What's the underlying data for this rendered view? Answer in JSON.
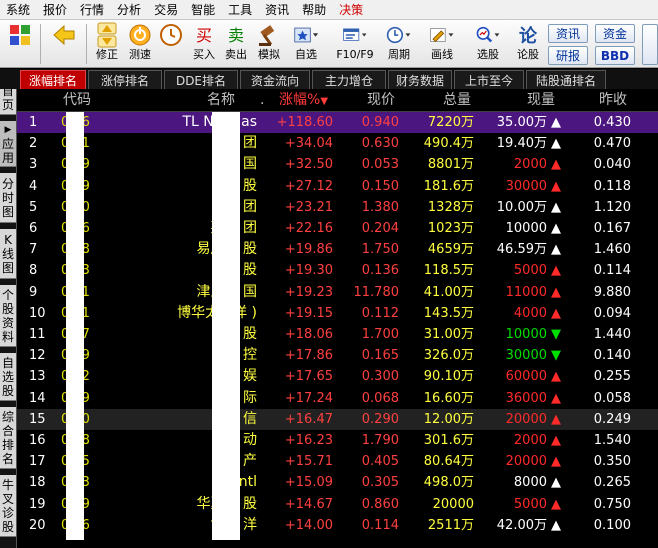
{
  "menu": [
    "系统",
    "报价",
    "行情",
    "分析",
    "交易",
    "智能",
    "工具",
    "资讯",
    "帮助",
    "决策"
  ],
  "toolbar": {
    "labels": [
      "修正",
      "测速",
      "买入",
      "卖出",
      "模拟",
      "自选",
      "F10/F9",
      "周期",
      "画线",
      "选股",
      "论股"
    ],
    "right_buttons": [
      "资讯",
      "资金",
      "研报",
      "BBD"
    ],
    "colors": {
      "buy": "#d00000",
      "sell": "#008000",
      "accent": "#003399"
    }
  },
  "tabs": [
    "涨幅排名",
    "涨停排名",
    "DDE排名",
    "资金流向",
    "主力增仓",
    "财务数据",
    "上市至今",
    "陆股通排名"
  ],
  "left_tabs": [
    "首页",
    "应用",
    "分时图",
    "K线图",
    "个股资料",
    "自选股",
    "综合排名",
    "牛叉诊股"
  ],
  "headers": {
    "code": "代码",
    "name": "名称",
    "dot": ".",
    "chg": "涨幅%",
    "sort_icon": "down-arrow",
    "price": "现价",
    "vol": "总量",
    "cur": "现量",
    "prev": "昨收"
  },
  "rows": [
    {
      "idx": "1",
      "code": "0   36",
      "name": "TL Natu      as",
      "chg": "+118.60",
      "price": "0.940",
      "vol": "7220万",
      "cur": "35.00万",
      "dir": "up",
      "cur_color": "white",
      "prev": "0.430"
    },
    {
      "idx": "2",
      "code": "0   01",
      "name": "源      团",
      "chg": "+34.04",
      "price": "0.630",
      "vol": "490.4万",
      "cur": "19.40万",
      "dir": "up",
      "cur_color": "white",
      "prev": "0.470"
    },
    {
      "idx": "3",
      "code": "0   09",
      "name": "新      国",
      "chg": "+32.50",
      "price": "0.053",
      "vol": "8801万",
      "cur": "2000",
      "dir": "up",
      "cur_color": "red",
      "prev": "0.040"
    },
    {
      "idx": "4",
      "code": "0   69",
      "name": "富      股",
      "chg": "+27.12",
      "price": "0.150",
      "vol": "181.6万",
      "cur": "30000",
      "dir": "up",
      "cur_color": "red",
      "prev": "0.118"
    },
    {
      "idx": "5",
      "code": "0   50",
      "name": "海      团",
      "chg": "+23.21",
      "price": "1.380",
      "vol": "1328万",
      "cur": "10.00万",
      "dir": "up",
      "cur_color": "white",
      "prev": "1.120"
    },
    {
      "idx": "6",
      "code": "0   36",
      "name": "英马      团",
      "chg": "+22.16",
      "price": "0.204",
      "vol": "1023万",
      "cur": "10000",
      "dir": "up",
      "cur_color": "white",
      "prev": "0.167"
    },
    {
      "idx": "7",
      "code": "0   48",
      "name": "易居企      股",
      "chg": "+19.86",
      "price": "1.750",
      "vol": "4659万",
      "cur": "46.59万",
      "dir": "up",
      "cur_color": "white",
      "prev": "1.460"
    },
    {
      "idx": "8",
      "code": "0   43",
      "name": "伟      股",
      "chg": "+19.30",
      "price": "0.136",
      "vol": "118.5万",
      "cur": "5000",
      "dir": "up",
      "cur_color": "red",
      "prev": "0.114"
    },
    {
      "idx": "9",
      "code": "0   51",
      "name": "津上机      国",
      "chg": "+19.23",
      "price": "11.780",
      "vol": "41.00万",
      "cur": "11000",
      "dir": "up",
      "cur_color": "red",
      "prev": "9.880"
    },
    {
      "idx": "10",
      "code": "0   71",
      "name": "博华太平洋    )",
      "chg": "+19.15",
      "price": "0.112",
      "vol": "143.5万",
      "cur": "4000",
      "dir": "up",
      "cur_color": "red",
      "prev": "0.094"
    },
    {
      "idx": "11",
      "code": "0   27",
      "name": "卓      股",
      "chg": "+18.06",
      "price": "1.700",
      "vol": "31.00万",
      "cur": "10000",
      "dir": "down",
      "cur_color": "green",
      "prev": "1.440"
    },
    {
      "idx": "12",
      "code": "0   49",
      "name": "瑞      控",
      "chg": "+17.86",
      "price": "0.165",
      "vol": "326.0万",
      "cur": "30000",
      "dir": "down",
      "cur_color": "green",
      "prev": "0.140"
    },
    {
      "idx": "13",
      "code": "0   72",
      "name": "拉      娱",
      "chg": "+17.65",
      "price": "0.300",
      "vol": "90.10万",
      "cur": "60000",
      "dir": "up",
      "cur_color": "red",
      "prev": "0.255"
    },
    {
      "idx": "14",
      "code": "0   69",
      "name": "华      际",
      "chg": "+17.24",
      "price": "0.068",
      "vol": "16.60万",
      "cur": "36000",
      "dir": "up",
      "cur_color": "red",
      "prev": "0.058"
    },
    {
      "idx": "15",
      "code": "0   60",
      "name": "国      信",
      "chg": "+16.47",
      "price": "0.290",
      "vol": "12.00万",
      "cur": "20000",
      "dir": "up",
      "cur_color": "red",
      "prev": "0.249"
    },
    {
      "idx": "16",
      "code": "0   98",
      "name": "家      动",
      "chg": "+16.23",
      "price": "1.790",
      "vol": "301.6万",
      "cur": "2000",
      "dir": "up",
      "cur_color": "red",
      "prev": "1.540"
    },
    {
      "idx": "17",
      "code": "0   25",
      "name": "亚      产",
      "chg": "+15.71",
      "price": "0.405",
      "vol": "80.64万",
      "cur": "20000",
      "dir": "up",
      "cur_color": "red",
      "prev": "0.350"
    },
    {
      "idx": "18",
      "code": "0   83",
      "name": "G      ntl",
      "chg": "+15.09",
      "price": "0.305",
      "vol": "498.0万",
      "cur": "8000",
      "dir": "up",
      "cur_color": "white",
      "prev": "0.265"
    },
    {
      "idx": "19",
      "code": "0   09",
      "name": "华夏能      股",
      "chg": "+14.67",
      "price": "0.860",
      "vol": "20000",
      "cur": "5000",
      "dir": "up",
      "cur_color": "red",
      "prev": "0.750"
    },
    {
      "idx": "20",
      "code": "0   76",
      "name": "博华      洋",
      "chg": "+14.00",
      "price": "0.114",
      "vol": "2511万",
      "cur": "42.00万",
      "dir": "up",
      "cur_color": "white",
      "prev": "0.100"
    }
  ]
}
